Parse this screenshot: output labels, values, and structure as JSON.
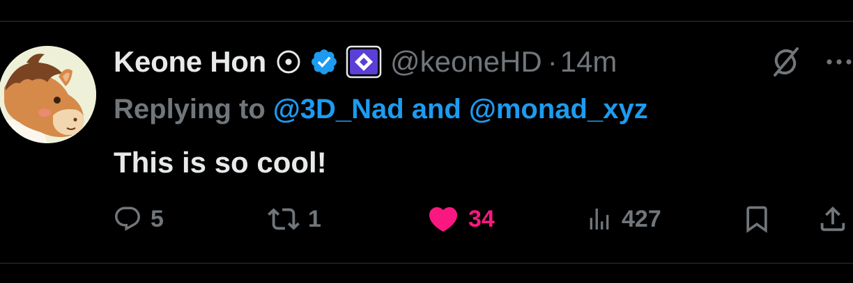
{
  "tweet": {
    "author": {
      "display_name": "Keone Hon",
      "handle": "@keoneHD",
      "avatar_icon": "horse-avatar-icon",
      "verified": true,
      "verified_color": "#1d9bf0",
      "affiliation_icon": "monad-logo-icon",
      "affiliation_color": "#5b3fd6"
    },
    "separator": "·",
    "timestamp": "14m",
    "reply_context": {
      "prefix": "Replying to",
      "mentions": [
        "@3D_Nad",
        "@monad_xyz"
      ],
      "conjunction": "and"
    },
    "text": "This is so cool!",
    "actions": {
      "replies": "5",
      "retweets": "1",
      "likes": "34",
      "liked": true,
      "views": "427"
    }
  },
  "colors": {
    "background": "#000000",
    "text_primary": "#e7e9ea",
    "text_secondary": "#71767b",
    "link": "#1d9bf0",
    "like": "#f91880",
    "divider": "#2f3336"
  }
}
